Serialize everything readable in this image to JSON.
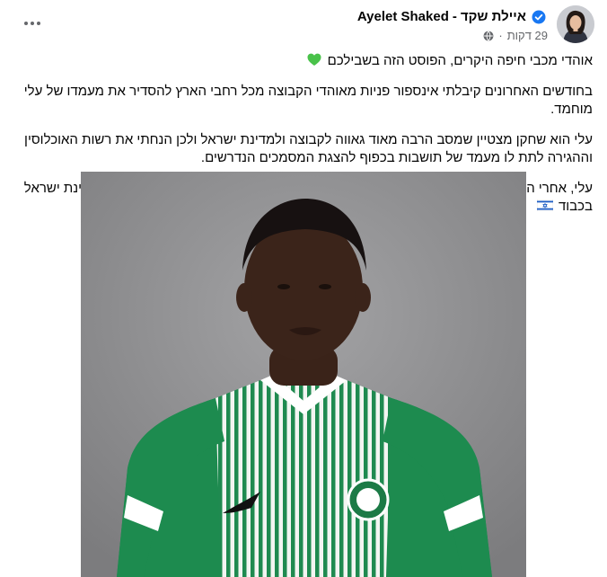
{
  "author": {
    "name_he": "איילת שקד",
    "separator": "-",
    "name_en": "Ayelet Shaked",
    "verified": true
  },
  "meta": {
    "time": "29 דקות",
    "dot": "·",
    "audience_icon": "globe-icon"
  },
  "post": {
    "paragraphs": [
      "אוהדי מכבי חיפה היקרים, הפוסט הזה בשבילכם",
      "בחודשים האחרונים קיבלתי אינספור פניות מאוהדי הקבוצה מכל רחבי הארץ להסדיר את מעמדו של עלי מוחמד.",
      "עלי הוא שחקן מצטיין שמסב הרבה מאוד גאווה לקבוצה ולמדינת ישראל ולכן הנחתי את רשות האוכלוסין וההגירה לתת לו מעמד של תושבות בכפוף להצגת המסמכים הנדרשים.",
      "עלי, אחרי העלייה המרגשת לליגת האלופות אני סומכת עליייך ועל מכבי חיפה שתייצגו את מדינת ישראל בכבוד"
    ],
    "emoji_1": "green-heart-icon",
    "emoji_4": "israel-flag-icon"
  },
  "colors": {
    "verified_blue": "#1877f2",
    "secondary_text": "#65676b",
    "jersey_green": "#1c8a4f",
    "background_photo": "#8f8f91"
  }
}
